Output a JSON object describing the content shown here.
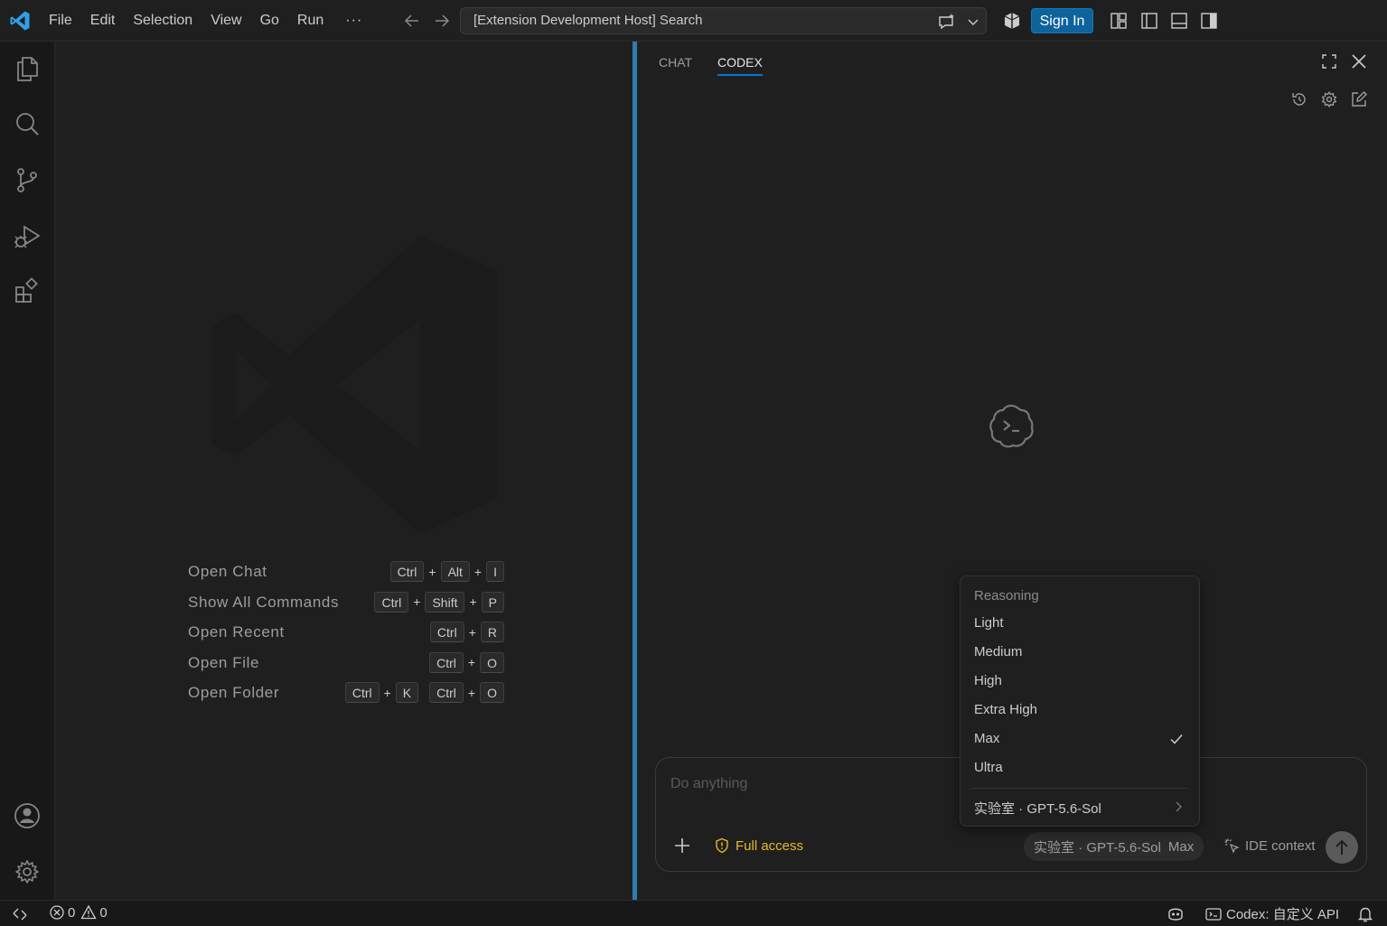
{
  "titlebar": {
    "menu": [
      "File",
      "Edit",
      "Selection",
      "View",
      "Go",
      "Run"
    ],
    "more": "···",
    "command_center": "[Extension Development Host] Search",
    "sign_in": "Sign In"
  },
  "activity_bar": {
    "items": [
      "files-icon",
      "search-icon",
      "source-control-icon",
      "run-debug-icon",
      "extensions-icon"
    ],
    "bottom": [
      "account-icon",
      "settings-gear-icon"
    ]
  },
  "editor": {
    "shortcuts": [
      {
        "label": "Open Chat",
        "chords": [
          [
            "Ctrl",
            "Alt",
            "I"
          ]
        ]
      },
      {
        "label": "Show All Commands",
        "chords": [
          [
            "Ctrl",
            "Shift",
            "P"
          ]
        ]
      },
      {
        "label": "Open Recent",
        "chords": [
          [
            "Ctrl",
            "R"
          ]
        ]
      },
      {
        "label": "Open File",
        "chords": [
          [
            "Ctrl",
            "O"
          ]
        ]
      },
      {
        "label": "Open Folder",
        "chords": [
          [
            "Ctrl",
            "K"
          ],
          [
            "Ctrl",
            "O"
          ]
        ]
      }
    ],
    "key_separator": "+"
  },
  "panel": {
    "tabs": [
      {
        "label": "CHAT",
        "active": false
      },
      {
        "label": "CODEX",
        "active": true
      }
    ],
    "composer": {
      "placeholder": "Do anything",
      "access": "Full access",
      "model_name": "实验室 · GPT-5.6-Sol",
      "model_effort": "Max",
      "ide_context": "IDE context"
    },
    "reasoning_menu": {
      "header": "Reasoning",
      "options": [
        "Light",
        "Medium",
        "High",
        "Extra High",
        "Max",
        "Ultra"
      ],
      "selected": "Max",
      "submenu": "实验室 · GPT-5.6-Sol"
    }
  },
  "statusbar": {
    "errors": "0",
    "warnings": "0",
    "codex": "Codex: 自定义 API"
  },
  "colors": {
    "accent": "#0078d4",
    "sign_in_bg": "#0e639c",
    "sash": "#2f7ab0",
    "full_access": "#e8b923"
  }
}
